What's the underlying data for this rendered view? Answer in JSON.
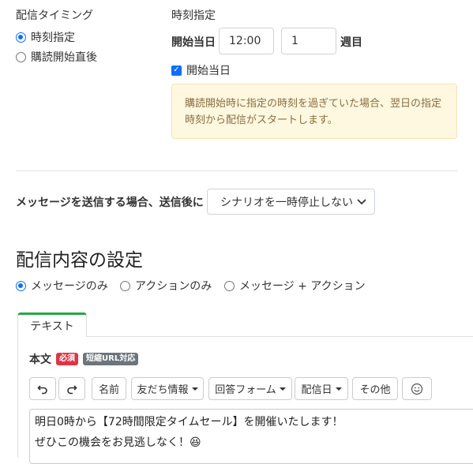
{
  "delivery_timing": {
    "title": "配信タイミング",
    "options": [
      "時刻指定",
      "購読開始直後"
    ],
    "selected": 0
  },
  "time_spec": {
    "title": "時刻指定",
    "start_day_label": "開始当日",
    "time_value": "12:00",
    "week_value": "1",
    "week_suffix": "週目",
    "checkbox_label": "開始当日",
    "checkbox_checked": true,
    "notice": "購読開始時に指定の時刻を過ぎていた場合、翌日の指定時刻から配信がスタートします。"
  },
  "after_send": {
    "label": "メッセージを送信する場合、送信後に",
    "select_value": "シナリオを一時停止しない"
  },
  "content_settings": {
    "title": "配信内容の設定",
    "modes": [
      "メッセージのみ",
      "アクションのみ",
      "メッセージ + アクション"
    ],
    "selected": 0
  },
  "tabs": [
    "テキスト"
  ],
  "body": {
    "label": "本文",
    "badge_required": "必須",
    "badge_short_url": "短縮URL対応",
    "toolbar": {
      "name": "名前",
      "friend_info": "友だち情報",
      "answer_form": "回答フォーム",
      "delivery_date": "配信日",
      "other": "その他"
    },
    "text_line1": "明日0時から【72時間限定タイムセール】を開催いたします！",
    "text_line2": "ぜひこの機会をお見逃しなく！😆"
  },
  "colors": {
    "primary": "#0d6efd",
    "tab_accent": "#28a745",
    "badge_required": "#dc3545",
    "badge_short_url": "#6c757d",
    "notice_bg": "#fff8e1"
  }
}
